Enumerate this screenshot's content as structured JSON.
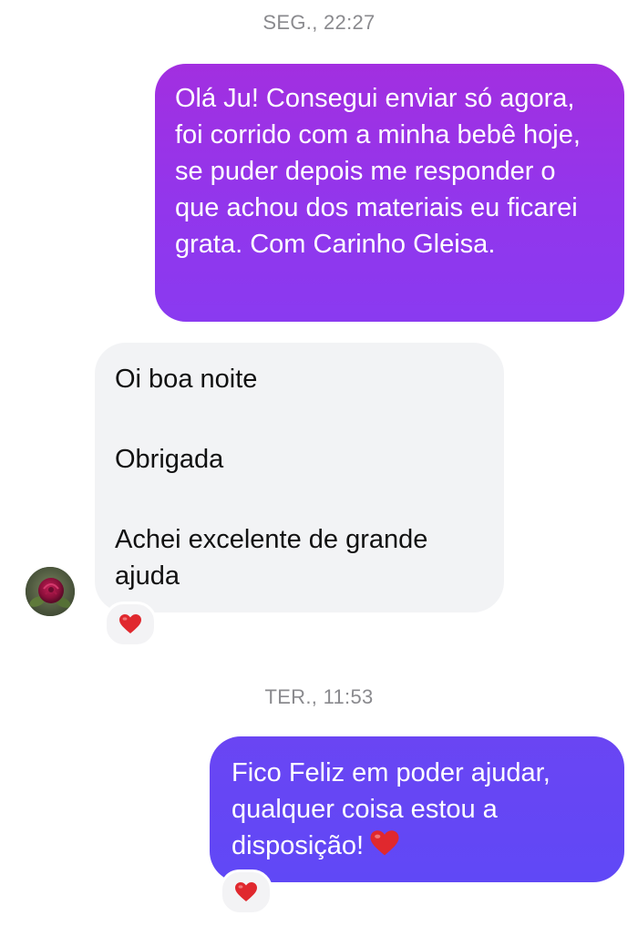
{
  "colors": {
    "outgoing_top": "#a22fe0",
    "outgoing_bottom": "#6048f6",
    "incoming_bg": "#f2f3f5",
    "timestamp_text": "#8a8a8e",
    "heart": "#e0282e"
  },
  "conversation": {
    "timestamp_1": "SEG., 22:27",
    "message_1": {
      "direction": "outgoing",
      "text": "Olá Ju! Consegui enviar só agora, foi corrido com a minha bebê hoje, se puder depois me responder o que achou dos materiais eu ficarei grata. Com Carinho Gleisa."
    },
    "message_2": {
      "direction": "incoming",
      "line_1": "Oi boa noite",
      "line_2": "Obrigada",
      "line_3": "Achei excelente de grande ajuda",
      "reaction_icon": "heart-icon"
    },
    "avatar_icon": "rose-icon",
    "timestamp_2": "TER., 11:53",
    "message_3": {
      "direction": "outgoing",
      "text": "Fico Feliz em poder ajudar, qualquer coisa estou a disposição!",
      "inline_icon": "heart-icon",
      "reaction_icon": "heart-icon"
    }
  }
}
